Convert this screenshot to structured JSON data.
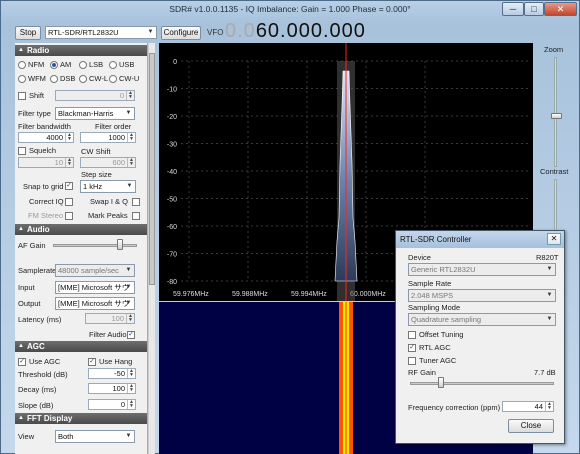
{
  "window": {
    "title": "SDR# v1.0.0.1135 - IQ Imbalance: Gain = 1.000 Phase = 0.000°",
    "minimize": "─",
    "maximize": "□",
    "close": "✕"
  },
  "toolbar": {
    "stop_label": "Stop",
    "source": "RTL-SDR/RTL2832U",
    "configure_label": "Configure",
    "vfo_label": "VFO",
    "vfo_dim": "0.0",
    "vfo_value": "60.000.000"
  },
  "radio": {
    "header": "Radio",
    "modes": [
      "NFM",
      "AM",
      "LSB",
      "USB",
      "WFM",
      "DSB",
      "CW-L",
      "CW-U"
    ],
    "selected_mode": "AM",
    "shift_label": "Shift",
    "shift_value": "0",
    "filter_type_label": "Filter type",
    "filter_type": "Blackman-Harris",
    "filter_bandwidth_label": "Filter bandwidth",
    "filter_bandwidth": "4000",
    "filter_order_label": "Filter order",
    "filter_order": "1000",
    "squelch_label": "Squelch",
    "squelch_value": "10",
    "cw_shift_label": "CW Shift",
    "cw_shift_value": "600",
    "step_size_label": "Step size",
    "snap_label": "Snap to grid",
    "step_size": "1 kHz",
    "correct_iq_label": "Correct IQ",
    "swap_iq_label": "Swap I & Q",
    "fm_stereo_label": "FM Stereo",
    "mark_peaks_label": "Mark Peaks"
  },
  "audio": {
    "header": "Audio",
    "af_gain_label": "AF Gain",
    "af_gain_level": 0.8,
    "samplerate_label": "Samplerate",
    "samplerate": "48000 sample/sec",
    "input_label": "Input",
    "input": "[MME] Microsoft サウ",
    "output_label": "Output",
    "output": "[MME] Microsoft サウ",
    "latency_label": "Latency (ms)",
    "latency": "100",
    "filter_audio_label": "Filter Audio"
  },
  "agc": {
    "header": "AGC",
    "use_agc_label": "Use AGC",
    "use_hang_label": "Use Hang",
    "threshold_label": "Threshold (dB)",
    "threshold": "-50",
    "decay_label": "Decay (ms)",
    "decay": "100",
    "slope_label": "Slope (dB)",
    "slope": "0"
  },
  "fft": {
    "header": "FFT Display",
    "view_label": "View",
    "view": "Both"
  },
  "side": {
    "zoom_label": "Zoom",
    "contrast_label": "Contrast"
  },
  "spectrum": {
    "y_ticks": [
      "0",
      "-10",
      "-20",
      "-30",
      "-40",
      "-50",
      "-60",
      "-70",
      "-80"
    ],
    "x_ticks": [
      "59.976MHz",
      "59.988MHz",
      "59.994MHz",
      "60.000MHz",
      "60.006MHz"
    ]
  },
  "dialog": {
    "title": "RTL-SDR Controller",
    "close": "✕",
    "device_label": "Device",
    "device_tuner": "R820T",
    "device": "Generic RTL2832U",
    "sample_rate_label": "Sample Rate",
    "sample_rate": "2.048 MSPS",
    "sampling_mode_label": "Sampling Mode",
    "sampling_mode": "Quadrature sampling",
    "offset_tuning_label": "Offset Tuning",
    "rtl_agc_label": "RTL AGC",
    "tuner_agc_label": "Tuner AGC",
    "rf_gain_label": "RF Gain",
    "rf_gain_value": "7.7 dB",
    "rf_gain_level": 0.2,
    "freq_corr_label": "Frequency correction (ppm)",
    "freq_corr": "44",
    "close_label": "Close"
  },
  "colors": {
    "spectrum_fill": "#6f86b0",
    "waterfall_bg": "#000044",
    "signal": "#ffee00",
    "marker": "#ff2222"
  }
}
